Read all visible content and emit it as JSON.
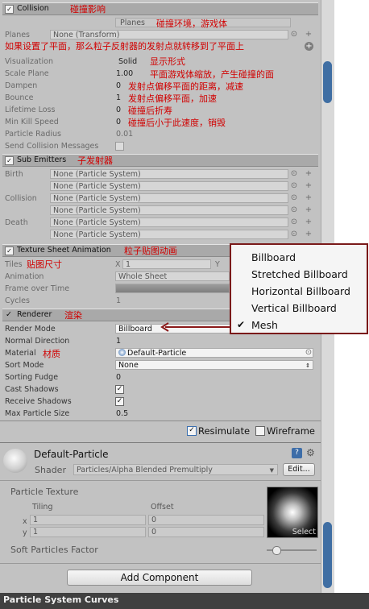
{
  "collision": {
    "header": "Collision",
    "header_note": "碰撞影响",
    "type_value": "Planes",
    "type_note": "碰撞环境，游戏体",
    "planes_label": "Planes",
    "planes_value": "None (Transform)",
    "planes_note": "如果设置了平面，那么粒子反射器的发射点就转移到了平面上",
    "visualization_label": "Visualization",
    "visualization_value": "Solid",
    "visualization_note": "显示形式",
    "scale_plane_label": "Scale Plane",
    "scale_plane_value": "1.00",
    "scale_plane_note": "平面游戏体缩放，产生碰撞的面",
    "dampen_label": "Dampen",
    "dampen_value": "0",
    "dampen_note": "发射点偏移平面的距离，减速",
    "bounce_label": "Bounce",
    "bounce_value": "1",
    "bounce_note": "发射点偏移平面，加速",
    "lifetime_loss_label": "Lifetime Loss",
    "lifetime_loss_value": "0",
    "lifetime_loss_note": "碰撞后折寿",
    "min_kill_label": "Min Kill Speed",
    "min_kill_value": "0",
    "min_kill_note": "碰撞后小于此速度，销毁",
    "particle_radius_label": "Particle Radius",
    "particle_radius_value": "0.01",
    "send_messages_label": "Send Collision Messages"
  },
  "sub_emitters": {
    "header": "Sub Emitters",
    "header_note": "子发射器",
    "birth_label": "Birth",
    "collision_label": "Collision",
    "death_label": "Death",
    "none_value": "None (Particle System)"
  },
  "texture_sheet": {
    "header": "Texture Sheet Animation",
    "header_note": "粒子贴图动画",
    "tiles_label": "Tiles",
    "tiles_note": "贴图尺寸",
    "tiles_x_label": "X",
    "tiles_x_value": "1",
    "tiles_y_label": "Y",
    "animation_label": "Animation",
    "animation_value": "Whole Sheet",
    "frame_label": "Frame over Time",
    "cycles_label": "Cycles",
    "cycles_value": "1"
  },
  "renderer": {
    "header": "Renderer",
    "header_note": "渲染",
    "render_mode_label": "Render Mode",
    "render_mode_value": "Billboard",
    "normal_dir_label": "Normal Direction",
    "normal_dir_value": "1",
    "material_label": "Material",
    "material_note": "材质",
    "material_value": "Default-Particle",
    "sort_mode_label": "Sort Mode",
    "sort_mode_value": "None",
    "sorting_fudge_label": "Sorting Fudge",
    "sorting_fudge_value": "0",
    "cast_shadows_label": "Cast Shadows",
    "receive_shadows_label": "Receive Shadows",
    "max_particle_label": "Max Particle Size",
    "max_particle_value": "0.5"
  },
  "render_mode_popup": {
    "options": [
      "Billboard",
      "Stretched Billboard",
      "Horizontal Billboard",
      "Vertical Billboard",
      "Mesh"
    ],
    "checked": "Mesh"
  },
  "toggles": {
    "resimulate": "Resimulate",
    "wireframe": "Wireframe"
  },
  "material_panel": {
    "name": "Default-Particle",
    "shader_label": "Shader",
    "shader_value": "Particles/Alpha Blended Premultiply",
    "edit_button": "Edit...",
    "texture_label": "Particle Texture",
    "tiling_label": "Tiling",
    "offset_label": "Offset",
    "x_label": "x",
    "y_label": "y",
    "tiling_x": "1",
    "tiling_y": "1",
    "offset_x": "0",
    "offset_y": "0",
    "select_button": "Select",
    "soft_particles_label": "Soft Particles Factor",
    "soft_particles_value": 0.2
  },
  "add_component": "Add Component",
  "bottom_bar": "Particle System Curves",
  "colors": {
    "annotation": "#d10000",
    "popup_border": "#7a1a1a",
    "scroll_thumb": "#3f6ea3",
    "arrow": "#8b1a1a"
  }
}
